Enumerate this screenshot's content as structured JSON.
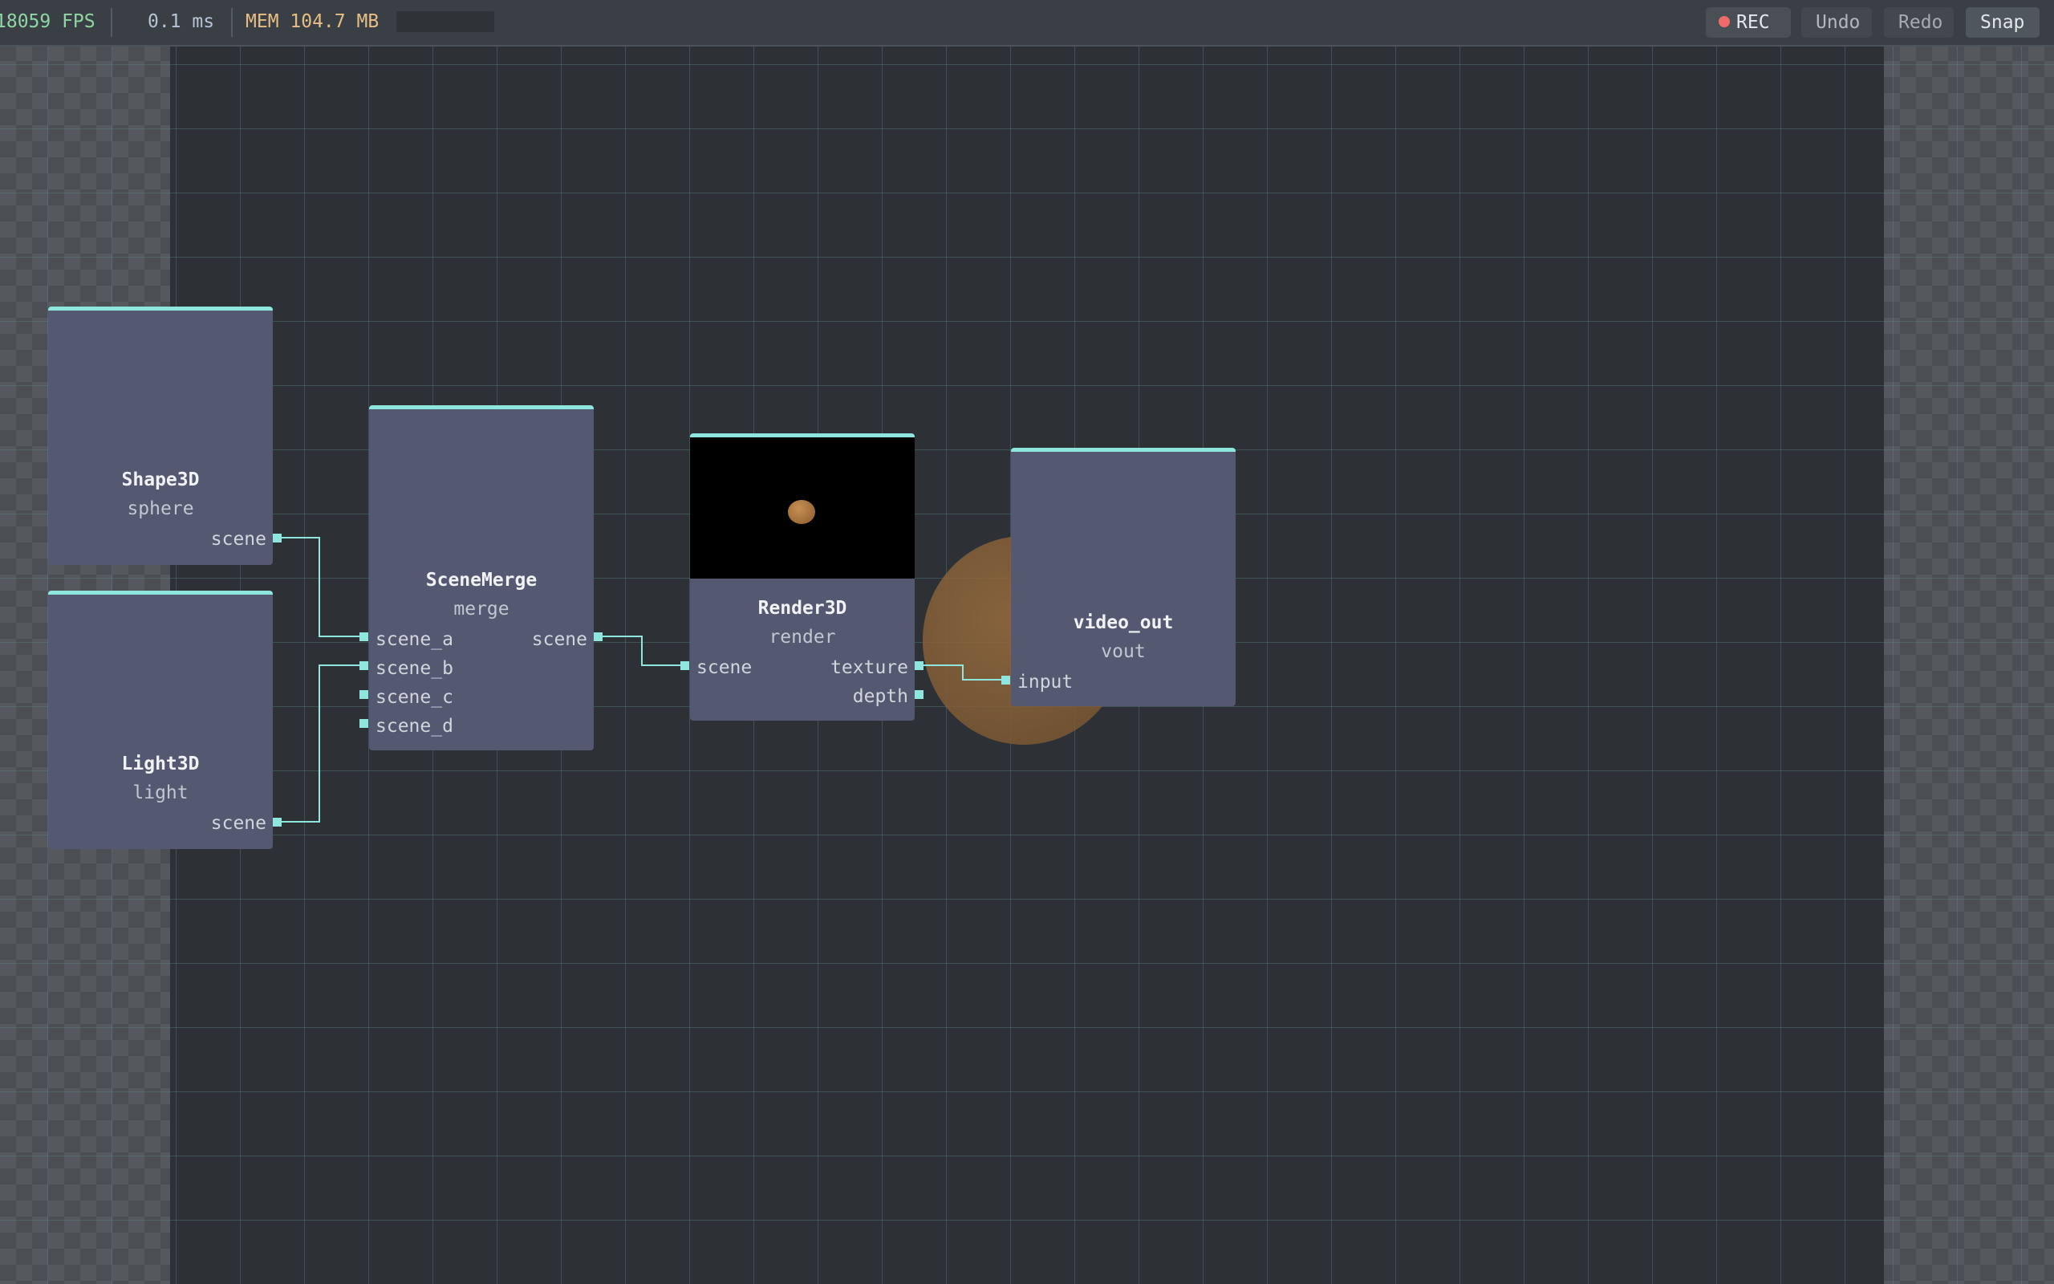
{
  "toolbar": {
    "fps": "18059 FPS",
    "frame_time": "0.1 ms",
    "memory": "MEM 104.7 MB",
    "rec_label": "REC",
    "undo_label": "Undo",
    "redo_label": "Redo",
    "snap_label": "Snap"
  },
  "nodes": {
    "shape3d": {
      "title": "Shape3D",
      "subtitle": "sphere",
      "outputs": [
        "scene"
      ]
    },
    "light3d": {
      "title": "Light3D",
      "subtitle": "light",
      "outputs": [
        "scene"
      ]
    },
    "scenemerge": {
      "title": "SceneMerge",
      "subtitle": "merge",
      "inputs": [
        "scene_a",
        "scene_b",
        "scene_c",
        "scene_d"
      ],
      "outputs": [
        "scene"
      ]
    },
    "render3d": {
      "title": "Render3D",
      "subtitle": "render",
      "inputs": [
        "scene"
      ],
      "outputs": [
        "texture",
        "depth"
      ]
    },
    "video_out": {
      "title": "video_out",
      "subtitle": "vout",
      "inputs": [
        "input"
      ]
    }
  },
  "colors": {
    "accent": "#8fe6df",
    "node_bg": "#545870",
    "canvas_bg": "#2d3136",
    "rec_dot": "#ef6b6b",
    "fps_text": "#8fd6a3",
    "mem_text": "#e7bd84"
  }
}
